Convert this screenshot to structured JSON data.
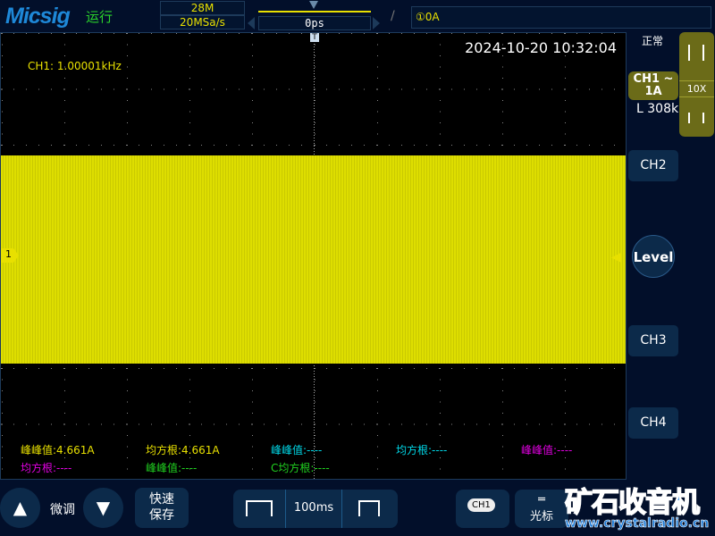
{
  "header": {
    "logo": "Micsig",
    "run_state": "运行",
    "memory_depth": "28M",
    "sample_rate": "20MSa/s",
    "trigger_position": "0ps",
    "trigger_slope_icon": "rising-edge-icon",
    "trigger_info": "①0A"
  },
  "screen": {
    "datetime": "2024-10-20 10:32:04",
    "frequency": "CH1: 1.00001kHz",
    "ch1_marker": "1",
    "measurements": [
      {
        "text": "峰峰值:4.661A",
        "color": "#e8e000"
      },
      {
        "text": "均方根:4.661A",
        "color": "#e8e000"
      },
      {
        "text": "峰峰值:----",
        "color": "#00d8e8"
      },
      {
        "text": "均方根:----",
        "color": "#00d8e8"
      },
      {
        "text": "峰峰值:----",
        "color": "#e000e0"
      },
      {
        "text": "均方根:----",
        "color": "#e000e0"
      },
      {
        "text": "峰峰值:----",
        "color": "#20d020"
      },
      {
        "text": "C均方根:----",
        "color": "#20d020"
      }
    ]
  },
  "right_panel": {
    "acq_mode": "正常",
    "ch1_label": "CH1 ~",
    "ch1_scale": "1A",
    "record_length": "L 308k",
    "probe": "10X",
    "ch2": "CH2",
    "level": "Level",
    "ch3": "CH3",
    "ch4": "CH4"
  },
  "bottom": {
    "fine_label": "微调",
    "quick_save": "快速\n保存",
    "timebase": "100ms",
    "ch1_button": "CH1",
    "cursor_label": "光标",
    "watermark": "矿石收音机",
    "watermark_url": "www.crystalradio.cn"
  },
  "colors": {
    "ch1": "#e8e000",
    "panel": "#0c2a4a",
    "background": "#020f2a"
  }
}
